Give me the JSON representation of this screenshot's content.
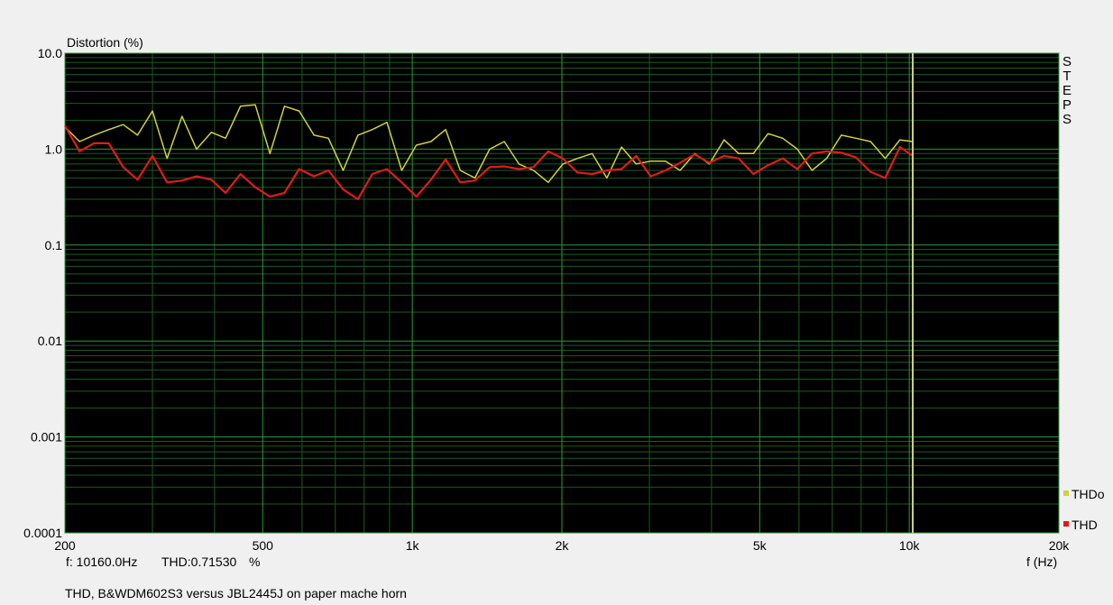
{
  "caption": "THD, B&WDM602S3 versus JBL2445J on paper mache horn",
  "cursor": {
    "freq_text": "f: 10160.0Hz",
    "thd_text": "THD:0.71530",
    "unit_text": "%"
  },
  "steps_label": "STEPS",
  "colors": {
    "plot_bg": "#000000",
    "grid_major": "#2f9a35",
    "grid_minor": "#1c5a22",
    "thdo": "#d2d23a",
    "thd": "#e11b1b",
    "cursor": "#d2d28c",
    "page_bg": "#f0f0f0"
  },
  "chart_data": {
    "type": "line",
    "title": "",
    "xlabel": "f (Hz)",
    "ylabel": "Distortion (%)",
    "x_scale": "log",
    "y_scale": "log",
    "xlim": [
      200,
      20000
    ],
    "ylim": [
      0.0001,
      10
    ],
    "x_ticks": [
      {
        "v": 200,
        "label": "200"
      },
      {
        "v": 500,
        "label": "500"
      },
      {
        "v": 1000,
        "label": "1k"
      },
      {
        "v": 2000,
        "label": "2k"
      },
      {
        "v": 5000,
        "label": "5k"
      },
      {
        "v": 10000,
        "label": "10k"
      },
      {
        "v": 20000,
        "label": "20k"
      }
    ],
    "y_ticks": [
      {
        "v": 10,
        "label": "10.0"
      },
      {
        "v": 1,
        "label": "1.0"
      },
      {
        "v": 0.1,
        "label": "0.1"
      },
      {
        "v": 0.01,
        "label": "0.01"
      },
      {
        "v": 0.001,
        "label": "0.001"
      },
      {
        "v": 0.0001,
        "label": "0.0001"
      }
    ],
    "grid": true,
    "legend_position": "bottom-right",
    "cursor_x": 10160,
    "series": [
      {
        "name": "THDo",
        "color": "#d2d23a",
        "x": [
          200,
          214,
          229,
          245,
          262,
          280,
          300,
          321,
          344,
          368,
          394,
          421,
          451,
          483,
          517,
          553,
          592,
          634,
          678,
          726,
          777,
          831,
          889,
          952,
          1019,
          1090,
          1167,
          1249,
          1337,
          1431,
          1531,
          1639,
          1754,
          1877,
          2009,
          2150,
          2301,
          2463,
          2636,
          2821,
          3019,
          3231,
          3458,
          3701,
          3961,
          4239,
          4537,
          4856,
          5197,
          5562,
          5953,
          6371,
          6819,
          7298,
          7811,
          8359,
          8947,
          9575,
          10160
        ],
        "y": [
          1.7,
          1.2,
          1.4,
          1.6,
          1.8,
          1.4,
          2.5,
          0.8,
          2.2,
          1.0,
          1.5,
          1.3,
          2.8,
          2.9,
          0.9,
          2.8,
          2.5,
          1.4,
          1.3,
          0.6,
          1.4,
          1.6,
          1.9,
          0.6,
          1.1,
          1.2,
          1.6,
          0.6,
          0.5,
          1.0,
          1.2,
          0.7,
          0.6,
          0.45,
          0.7,
          0.8,
          0.9,
          0.5,
          1.05,
          0.7,
          0.75,
          0.75,
          0.6,
          0.9,
          0.7,
          1.25,
          0.9,
          0.9,
          1.45,
          1.3,
          1.0,
          0.6,
          0.8,
          1.4,
          1.3,
          1.2,
          0.8,
          1.25,
          1.2
        ]
      },
      {
        "name": "THD",
        "color": "#e11b1b",
        "x": [
          200,
          214,
          229,
          245,
          262,
          280,
          300,
          321,
          344,
          368,
          394,
          421,
          451,
          483,
          517,
          553,
          592,
          634,
          678,
          726,
          777,
          831,
          889,
          952,
          1019,
          1090,
          1167,
          1249,
          1337,
          1431,
          1531,
          1639,
          1754,
          1877,
          2009,
          2150,
          2301,
          2463,
          2636,
          2821,
          3019,
          3231,
          3458,
          3701,
          3961,
          4239,
          4537,
          4856,
          5197,
          5562,
          5953,
          6371,
          6819,
          7298,
          7811,
          8359,
          8947,
          9575,
          10160
        ],
        "y": [
          1.75,
          0.95,
          1.15,
          1.15,
          0.65,
          0.48,
          0.85,
          0.45,
          0.47,
          0.52,
          0.48,
          0.35,
          0.55,
          0.4,
          0.32,
          0.35,
          0.62,
          0.52,
          0.6,
          0.38,
          0.3,
          0.55,
          0.62,
          0.45,
          0.32,
          0.48,
          0.78,
          0.45,
          0.47,
          0.65,
          0.66,
          0.62,
          0.65,
          0.95,
          0.8,
          0.57,
          0.55,
          0.6,
          0.62,
          0.85,
          0.52,
          0.6,
          0.72,
          0.88,
          0.72,
          0.85,
          0.8,
          0.55,
          0.68,
          0.8,
          0.62,
          0.9,
          0.95,
          0.92,
          0.82,
          0.58,
          0.5,
          1.05,
          0.85
        ]
      }
    ]
  }
}
